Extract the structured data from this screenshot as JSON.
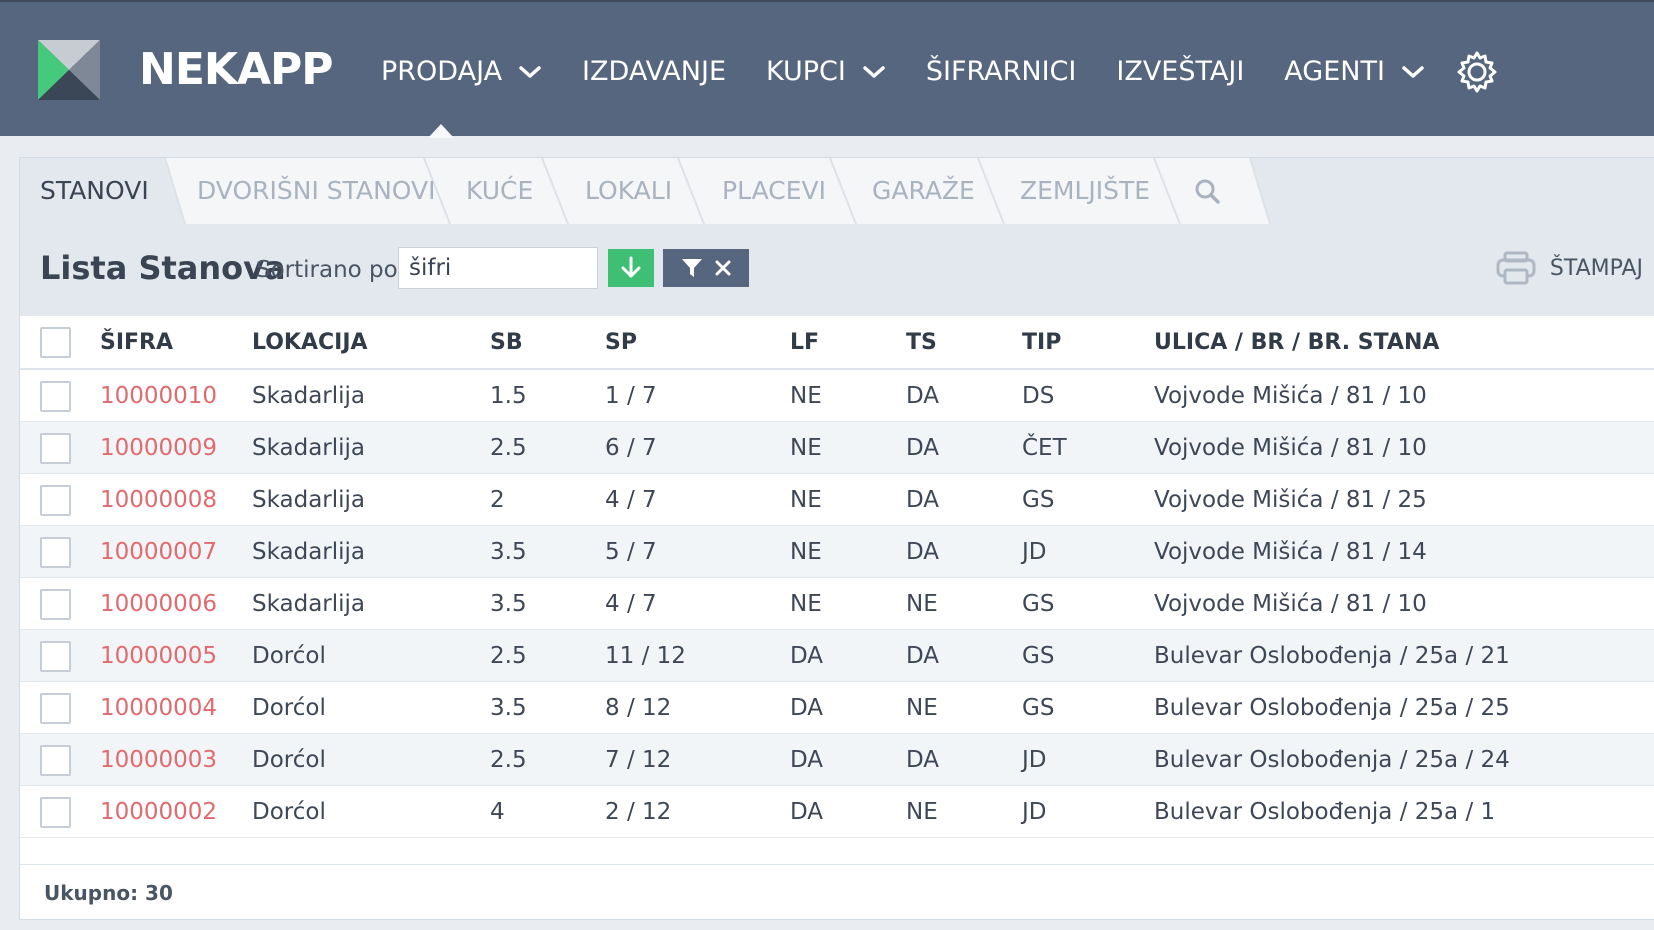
{
  "app": {
    "brand": "NEKAPP"
  },
  "nav": {
    "items": [
      {
        "label": "PRODAJA",
        "dropdown": true
      },
      {
        "label": "IZDAVANJE",
        "dropdown": false
      },
      {
        "label": "KUPCI",
        "dropdown": true
      },
      {
        "label": "ŠIFRARNICI",
        "dropdown": false
      },
      {
        "label": "IZVEŠTAJI",
        "dropdown": false
      },
      {
        "label": "AGENTI",
        "dropdown": true
      }
    ],
    "settings_icon": "gear-icon"
  },
  "tabs": [
    "STANOVI",
    "DVORIŠNI STANOVI",
    "KUĆE",
    "LOKALI",
    "PLACEVI",
    "GARAŽE",
    "ZEMLJIŠTE"
  ],
  "active_tab": "STANOVI",
  "toolbar": {
    "title": "Lista Stanova",
    "sort_label": "Sortirano po:",
    "sort_value": "šifri",
    "print_label": "ŠTAMPAJ"
  },
  "table": {
    "columns": [
      "ŠIFRA",
      "LOKACIJA",
      "SB",
      "SP",
      "LF",
      "TS",
      "TIP",
      "ULICA / BR / BR. STANA"
    ],
    "rows": [
      [
        "10000010",
        "Skadarlija",
        "1.5",
        "1 / 7",
        "NE",
        "DA",
        "DS",
        "Vojvode Mišića / 81 / 10"
      ],
      [
        "10000009",
        "Skadarlija",
        "2.5",
        "6 / 7",
        "NE",
        "DA",
        "ČET",
        "Vojvode Mišića / 81 / 10"
      ],
      [
        "10000008",
        "Skadarlija",
        "2",
        "4 / 7",
        "NE",
        "DA",
        "GS",
        "Vojvode Mišića / 81 / 25"
      ],
      [
        "10000007",
        "Skadarlija",
        "3.5",
        "5 / 7",
        "NE",
        "DA",
        "JD",
        "Vojvode Mišića / 81 / 14"
      ],
      [
        "10000006",
        "Skadarlija",
        "3.5",
        "4 / 7",
        "NE",
        "NE",
        "GS",
        "Vojvode Mišića / 81 / 10"
      ],
      [
        "10000005",
        "Dorćol",
        "2.5",
        "11 / 12",
        "DA",
        "DA",
        "GS",
        "Bulevar Oslobođenja / 25a / 21"
      ],
      [
        "10000004",
        "Dorćol",
        "3.5",
        "8 / 12",
        "DA",
        "NE",
        "GS",
        "Bulevar Oslobođenja / 25a / 25"
      ],
      [
        "10000003",
        "Dorćol",
        "2.5",
        "7 / 12",
        "DA",
        "DA",
        "JD",
        "Bulevar Oslobođenja / 25a / 24"
      ],
      [
        "10000002",
        "Dorćol",
        "4",
        "2 / 12",
        "DA",
        "NE",
        "JD",
        "Bulevar Oslobođenja / 25a / 1"
      ]
    ]
  },
  "footer": {
    "total": "Ukupno: 30"
  },
  "colors": {
    "nav_bg": "#56667e",
    "accent_green": "#3fbf74",
    "code_red": "#e06a6e"
  }
}
